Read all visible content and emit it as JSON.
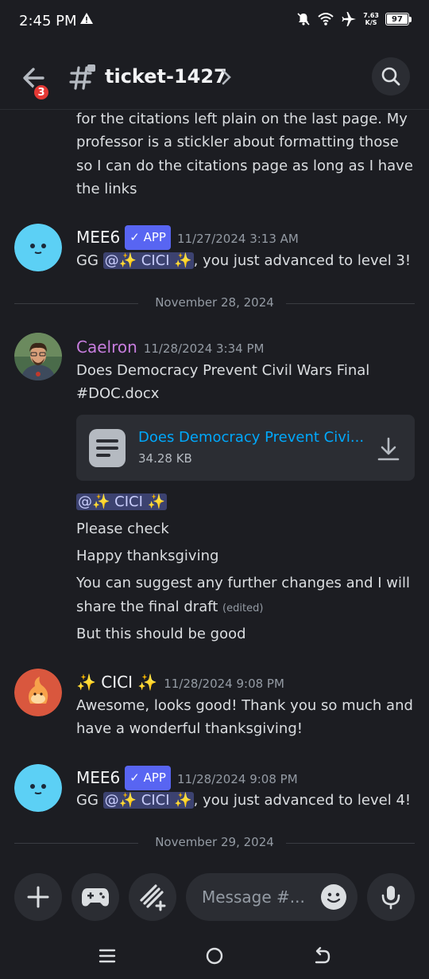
{
  "status": {
    "time": "2:45 PM",
    "net_speed": "7.63",
    "net_unit": "K/S",
    "battery": "97"
  },
  "header": {
    "channel": "ticket-1427",
    "back_badge": "3"
  },
  "messages": {
    "prev_lines": [
      "for the citations left plain on the last page. My",
      "professor is a stickler about formatting those",
      "so I can do the citations page as long as I have",
      "the links"
    ],
    "mee6_1": {
      "name": "MEE6",
      "tag": "✓ APP",
      "time": "11/27/2024 3:13 AM",
      "pre": "GG ",
      "mention": "@✨ CICI ✨",
      "post": ", you just advanced to level 3!"
    },
    "divider1": "November 28, 2024",
    "caelron": {
      "name": "Caelron",
      "time": "11/28/2024 3:34 PM",
      "line1": "Does Democracy Prevent Civil Wars Final",
      "line2": "#DOC.docx",
      "file_name": "Does Democracy Prevent Civi...",
      "file_size": "34.28 KB",
      "mention": "@✨ CICI ✨",
      "m1": "Please check",
      "m2": "Happy thanksgiving",
      "m3a": "You can  suggest any further changes and I will",
      "m3b": "share the final draft",
      "edited": "(edited)",
      "m4": "But this should be good"
    },
    "cici": {
      "name": "✨ CICI ✨",
      "time": "11/28/2024 9:08 PM",
      "line1": "Awesome, looks good! Thank you so much and",
      "line2": "have a wonderful thanksgiving!"
    },
    "mee6_2": {
      "name": "MEE6",
      "tag": "✓ APP",
      "time": "11/28/2024 9:08 PM",
      "pre": "GG ",
      "mention": "@✨ CICI ✨",
      "post": ", you just advanced to level 4!"
    },
    "divider2": "November 29, 2024"
  },
  "composer": {
    "placeholder": "Message #..."
  },
  "colors": {
    "accent": "#5865f2",
    "link": "#00a8fc",
    "caelron": "#c77dde",
    "bg": "#1c1d22"
  }
}
